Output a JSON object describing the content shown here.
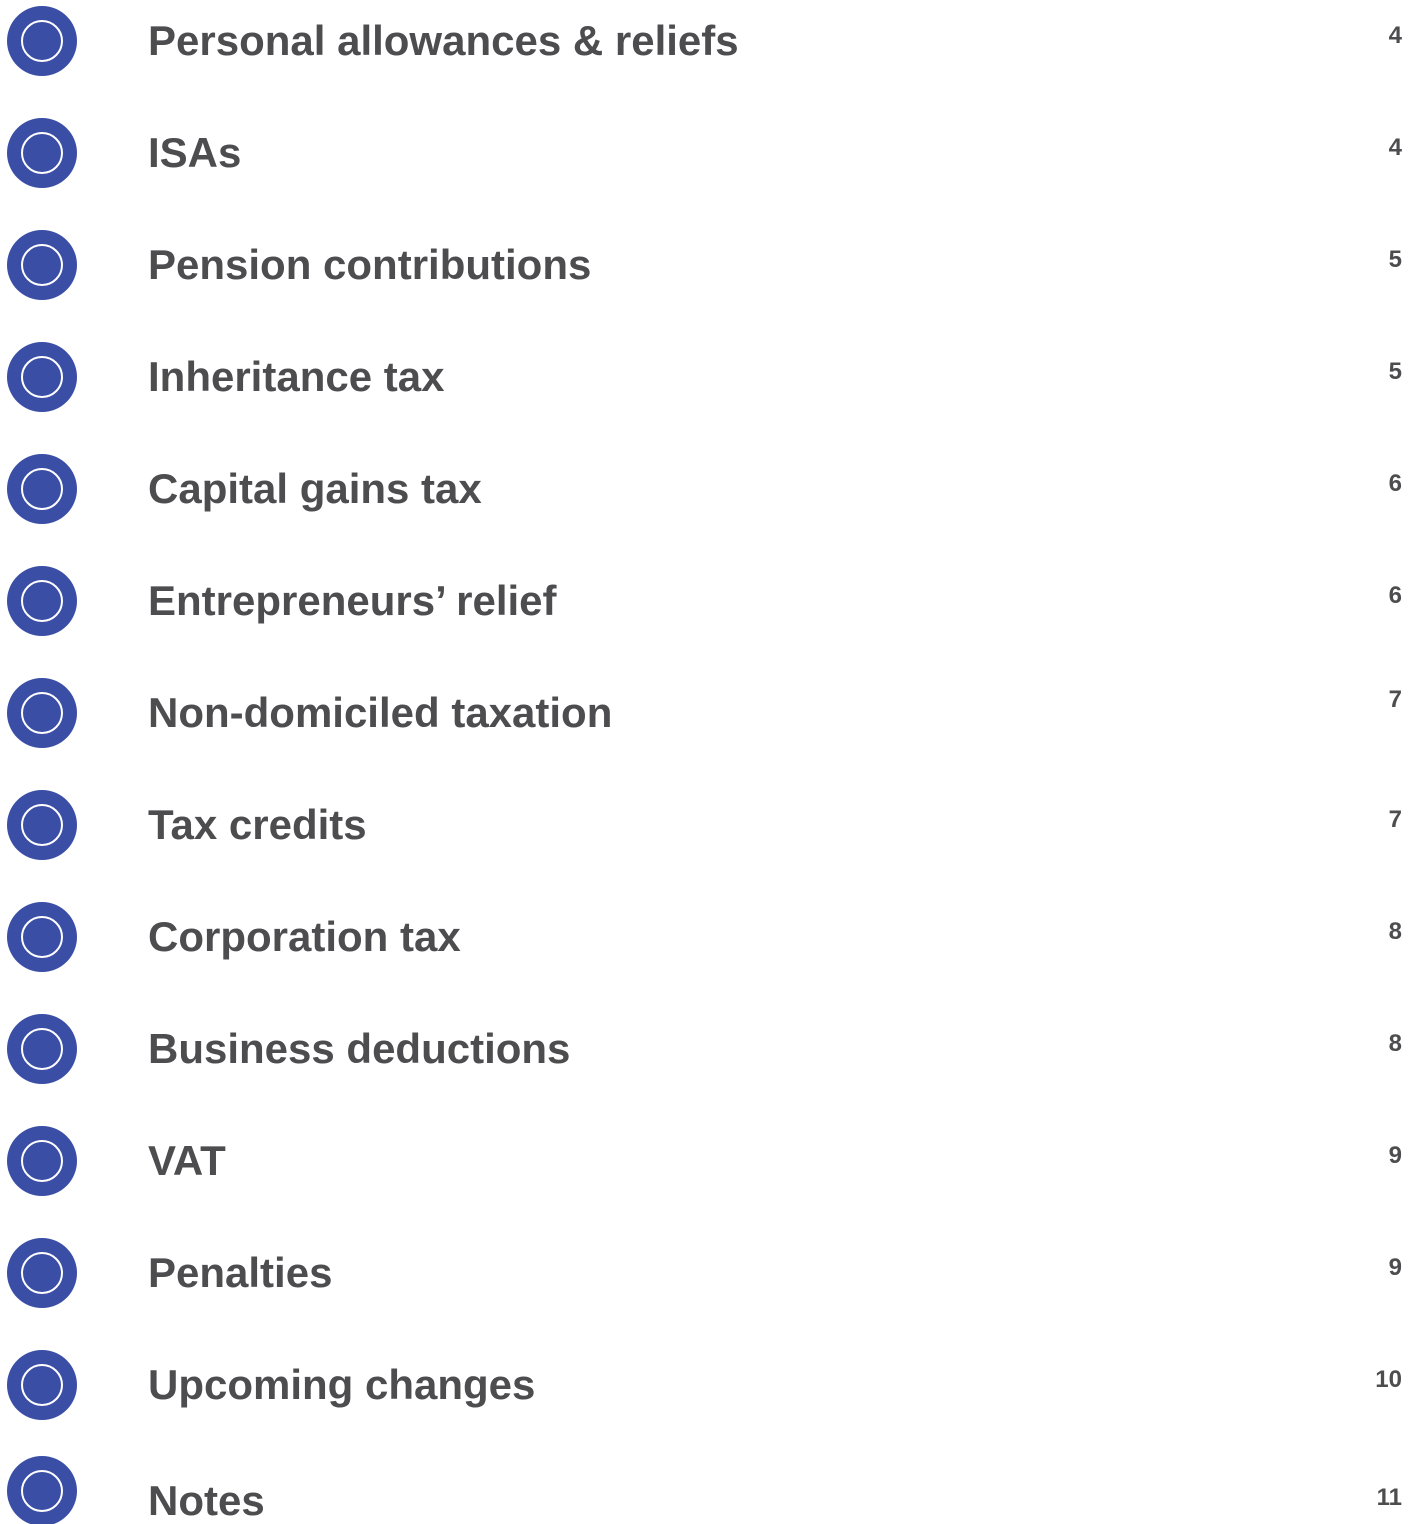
{
  "toc": {
    "accent_color": "#3a4ea5",
    "text_color": "#4d4d4f",
    "items": [
      {
        "title": "Personal allowances & reliefs",
        "page": "4"
      },
      {
        "title": "ISAs",
        "page": "4"
      },
      {
        "title": "Pension contributions",
        "page": "5"
      },
      {
        "title": "Inheritance tax",
        "page": "5"
      },
      {
        "title": "Capital gains tax",
        "page": "6"
      },
      {
        "title": "Entrepreneurs’ relief",
        "page": "6"
      },
      {
        "title": "Non-domiciled taxation",
        "page": "7"
      },
      {
        "title": "Tax credits",
        "page": "7"
      },
      {
        "title": "Corporation tax",
        "page": "8"
      },
      {
        "title": "Business deductions",
        "page": "8"
      },
      {
        "title": "VAT",
        "page": "9"
      },
      {
        "title": "Penalties",
        "page": "9"
      },
      {
        "title": "Upcoming changes",
        "page": "10"
      },
      {
        "title": "Notes",
        "page": "11"
      }
    ]
  }
}
